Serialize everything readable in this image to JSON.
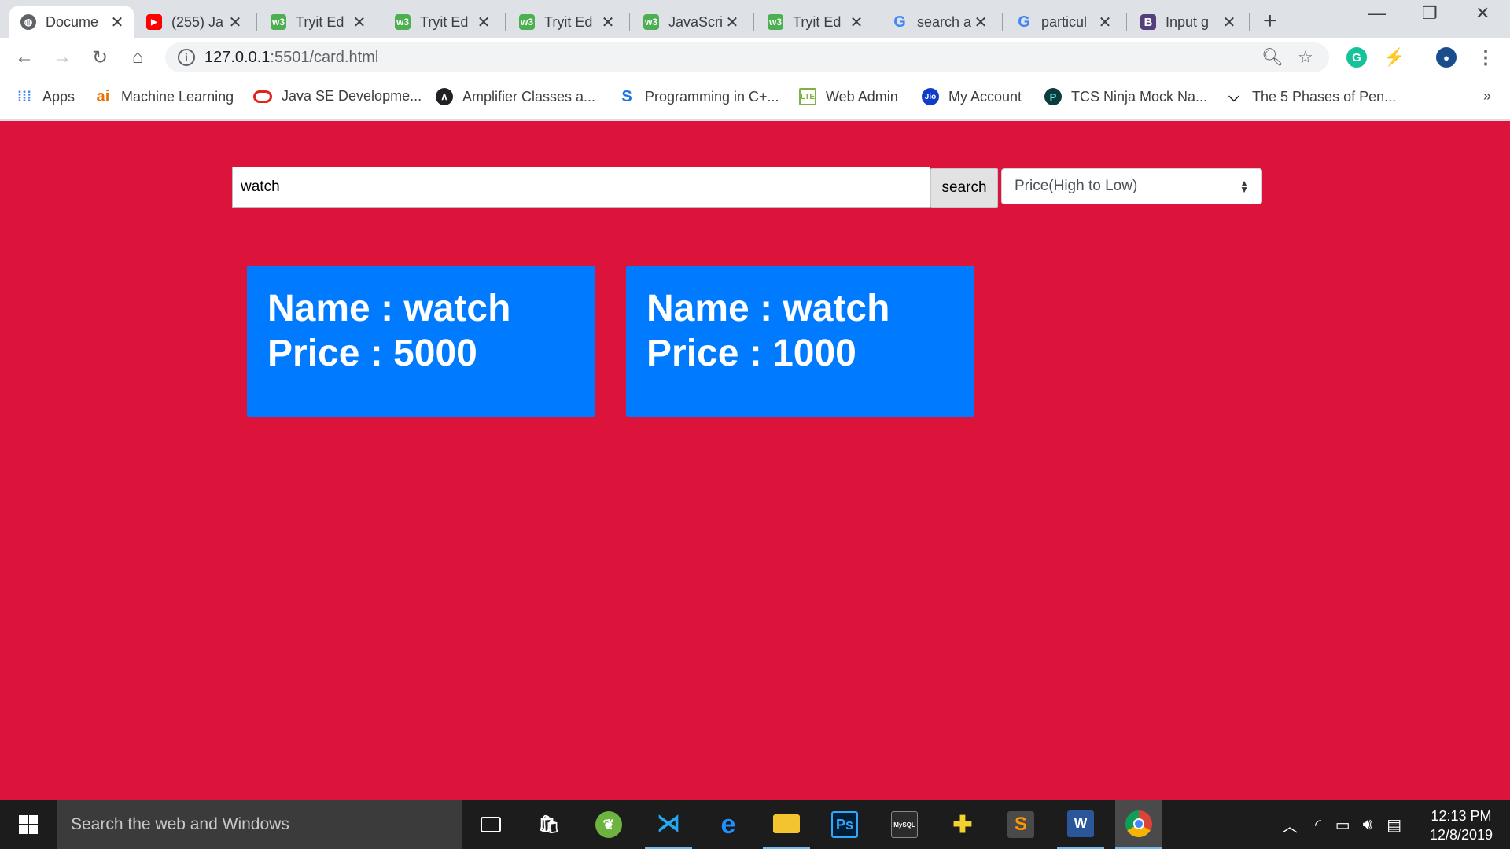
{
  "browser": {
    "tabs": [
      {
        "title": "Docume",
        "favicon": "globe-icon",
        "active": true
      },
      {
        "title": "(255) Ja",
        "favicon": "youtube-icon"
      },
      {
        "title": "Tryit Ed",
        "favicon": "w3schools-icon"
      },
      {
        "title": "Tryit Ed",
        "favicon": "w3schools-icon"
      },
      {
        "title": "Tryit Ed",
        "favicon": "w3schools-icon"
      },
      {
        "title": "JavaScri",
        "favicon": "w3schools-icon"
      },
      {
        "title": "Tryit Ed",
        "favicon": "w3schools-icon"
      },
      {
        "title": "search a",
        "favicon": "google-icon"
      },
      {
        "title": "particul",
        "favicon": "google-icon"
      },
      {
        "title": "Input g",
        "favicon": "bootstrap-icon"
      }
    ],
    "url_host": "127.0.0.1",
    "url_path": ":5501/card.html",
    "bookmarks": [
      {
        "label": "Apps",
        "icon": "apps-grid-icon"
      },
      {
        "label": "Machine Learning",
        "icon": "ai-icon"
      },
      {
        "label": "Java SE Developme...",
        "icon": "oracle-icon"
      },
      {
        "label": "Amplifier Classes a...",
        "icon": "amplifier-icon"
      },
      {
        "label": "Programming in C+...",
        "icon": "s-logo-icon"
      },
      {
        "label": "Web Admin",
        "icon": "lte-icon"
      },
      {
        "label": "My Account",
        "icon": "jio-icon"
      },
      {
        "label": "TCS Ninja Mock Na...",
        "icon": "prepinsta-icon"
      },
      {
        "label": "The 5 Phases of Pen...",
        "icon": "bookmark-icon"
      }
    ],
    "more_bookmarks": "»"
  },
  "page": {
    "background": "#dc143c",
    "search_value": "watch",
    "search_button": "search",
    "sort_selected": "Price(High to Low)",
    "cards": [
      {
        "name_line": "Name : watch",
        "price_line": "Price : 5000"
      },
      {
        "name_line": "Name : watch",
        "price_line": "Price : 1000"
      }
    ],
    "card_color": "#007bff"
  },
  "taskbar": {
    "search_placeholder": "Search the web and Windows",
    "apps": [
      "task-view-icon",
      "store-icon",
      "spring-icon",
      "vscode-icon",
      "edge-icon",
      "file-explorer-icon",
      "photoshop-icon",
      "mysql-icon",
      "game-icon",
      "sublime-icon",
      "word-icon",
      "chrome-icon"
    ],
    "time": "12:13 PM",
    "date": "12/8/2019"
  }
}
